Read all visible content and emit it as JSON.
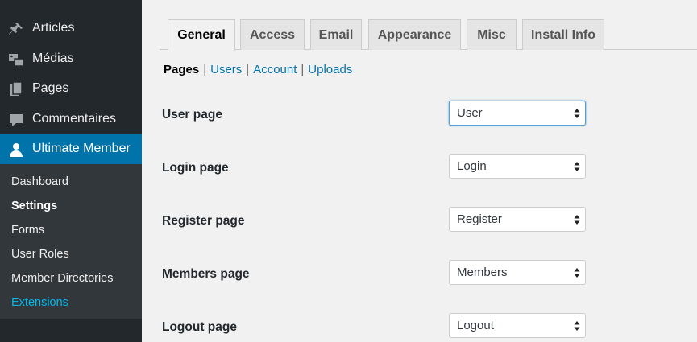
{
  "sidebar": {
    "items": [
      {
        "label": "Articles",
        "icon": "pin-icon"
      },
      {
        "label": "Médias",
        "icon": "media-icon"
      },
      {
        "label": "Pages",
        "icon": "pages-icon"
      },
      {
        "label": "Commentaires",
        "icon": "comment-icon"
      },
      {
        "label": "Ultimate Member",
        "icon": "user-icon"
      }
    ],
    "submenu": [
      {
        "label": "Dashboard"
      },
      {
        "label": "Settings"
      },
      {
        "label": "Forms"
      },
      {
        "label": "User Roles"
      },
      {
        "label": "Member Directories"
      },
      {
        "label": "Extensions"
      }
    ],
    "colors": {
      "bg": "#23282d",
      "active": "#0073aa",
      "submenu_bg": "#32373c",
      "highlight": "#00b9eb"
    }
  },
  "tabs": [
    "General",
    "Access",
    "Email",
    "Appearance",
    "Misc",
    "Install Info"
  ],
  "subnav": {
    "current": "Pages",
    "links": [
      "Users",
      "Account",
      "Uploads"
    ],
    "separator": "|"
  },
  "fields": [
    {
      "label": "User page",
      "value": "User"
    },
    {
      "label": "Login page",
      "value": "Login"
    },
    {
      "label": "Register page",
      "value": "Register"
    },
    {
      "label": "Members page",
      "value": "Members"
    },
    {
      "label": "Logout page",
      "value": "Logout"
    }
  ]
}
